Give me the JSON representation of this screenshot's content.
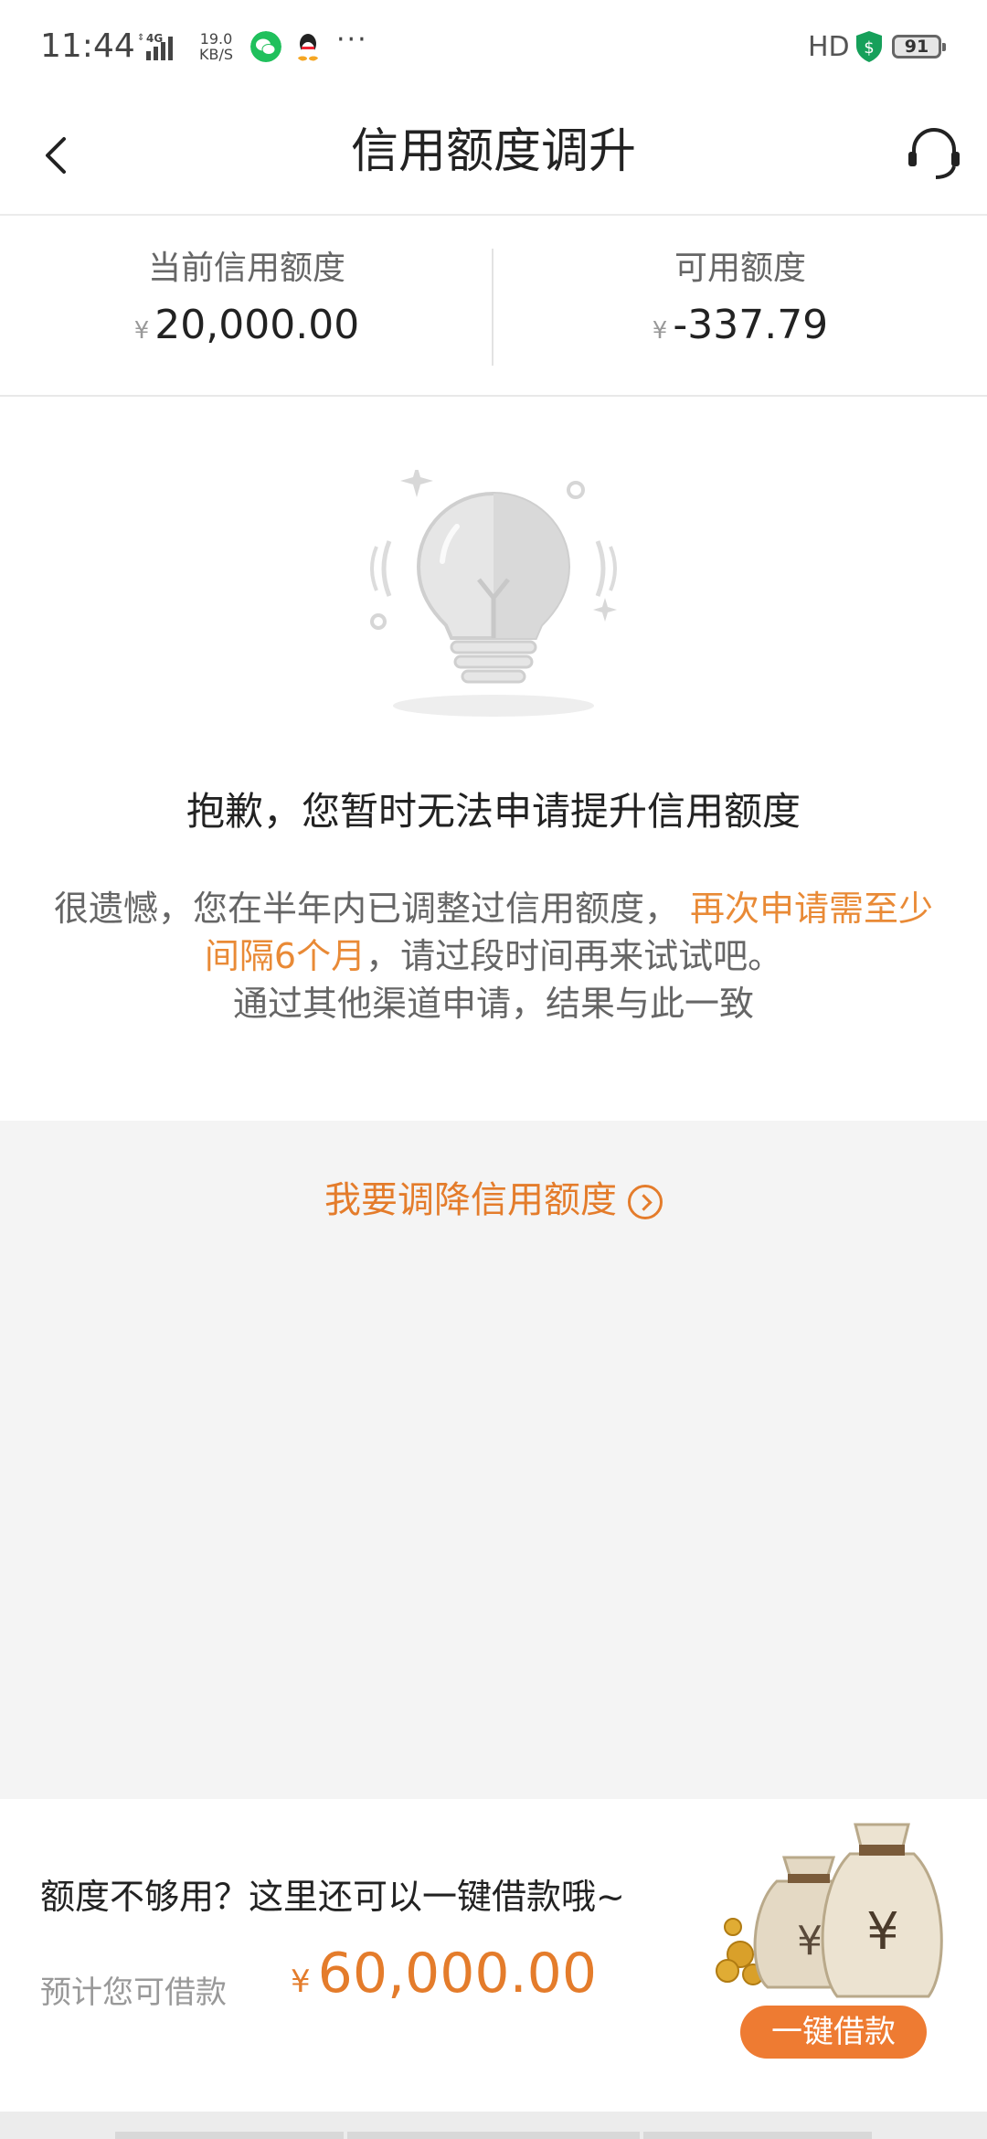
{
  "status_bar": {
    "time": "11:44",
    "network": "4G",
    "speed_value": "19.0",
    "speed_unit": "KB/S",
    "more": "···",
    "hd": "HD",
    "battery": "91",
    "icons": [
      "signal-icon",
      "wechat-icon",
      "qq-icon",
      "shield-icon",
      "battery-icon"
    ]
  },
  "header": {
    "title": "信用额度调升",
    "back_icon": "chevron-left-icon",
    "service_icon": "headset-icon"
  },
  "limits": {
    "current_label": "当前信用额度",
    "current_currency": "¥",
    "current_value": "20,000.00",
    "available_label": "可用额度",
    "available_currency": "¥",
    "available_value": "-337.79"
  },
  "message": {
    "title": "抱歉，您暂时无法申请提升信用额度",
    "body_part1": "很遗憾，您在半年内已调整过信用额度，",
    "body_highlight": "再次申请需至少间隔6个月",
    "body_part2": "，请过段时间再来试试吧。",
    "body_line3": "通过其他渠道申请，结果与此一致",
    "illustration": "lightbulb-icon"
  },
  "reduce": {
    "label": "我要调降信用额度",
    "icon": "circle-arrow-right-icon"
  },
  "loan": {
    "question": "额度不够用？这里还可以一键借款哦~",
    "estimate_label": "预计您可借款",
    "currency": "¥",
    "amount": "60,000.00",
    "button_label": "一键借款",
    "illustration": "money-bags-icon"
  },
  "colors": {
    "accent": "#e47c2b",
    "button": "#ee7b32",
    "text_primary": "#222222",
    "text_secondary": "#666666"
  }
}
